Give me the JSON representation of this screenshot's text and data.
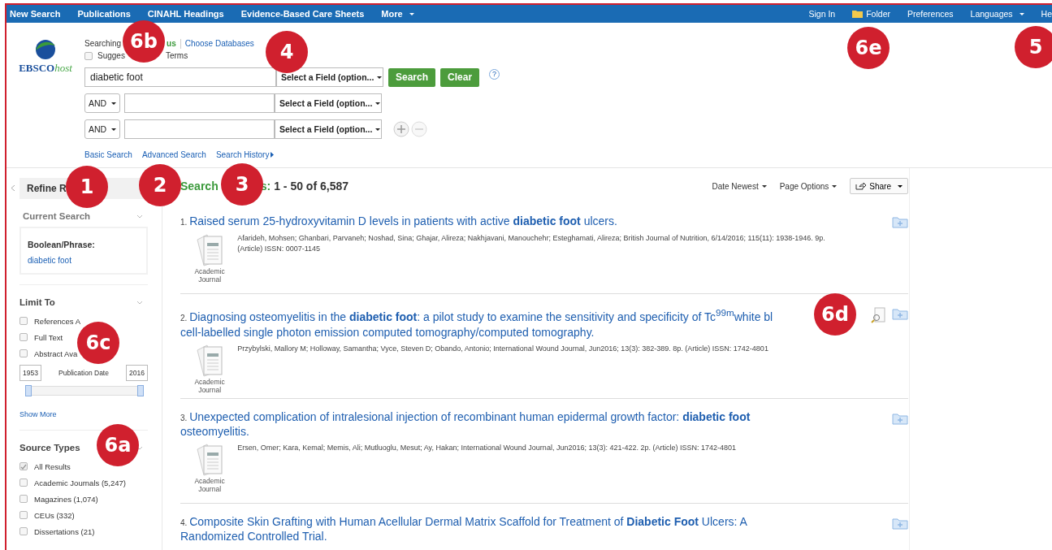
{
  "nav": {
    "left": [
      {
        "label": "New Search",
        "kind": "link"
      },
      {
        "label": "Publications",
        "kind": "link"
      },
      {
        "label": "CINAHL Headings",
        "kind": "link"
      },
      {
        "label": "Evidence-Based Care Sheets",
        "kind": "link"
      },
      {
        "label": "More",
        "kind": "dropdown"
      }
    ],
    "right": [
      {
        "label": "Sign In",
        "kind": "link"
      },
      {
        "label": "Folder",
        "kind": "folder"
      },
      {
        "label": "Preferences",
        "kind": "link"
      },
      {
        "label": "Languages",
        "kind": "dropdown"
      },
      {
        "label": "He",
        "kind": "link"
      }
    ]
  },
  "logo": {
    "text": "EBSCO",
    "suffix": "host"
  },
  "search": {
    "searching_label": "Searching",
    "database_fragment": "us",
    "choose_databases": "Choose Databases",
    "suggest": {
      "label_start": "Sugges",
      "label_end": "Terms",
      "checked": false
    },
    "rows": [
      {
        "kind": "first",
        "value": "diabetic foot",
        "field": "Select a Field (option..."
      },
      {
        "kind": "bool",
        "operator": "AND",
        "value": "",
        "field": "Select a Field (option..."
      },
      {
        "kind": "bool",
        "operator": "AND",
        "value": "",
        "field": "Select a Field (option..."
      }
    ],
    "search_button": "Search",
    "clear_button": "Clear",
    "help": "?",
    "links": [
      "Basic Search",
      "Advanced Search",
      "Search History"
    ]
  },
  "sidebar": {
    "title": "Refine R",
    "current_search": {
      "heading": "Current Search",
      "label": "Boolean/Phrase:",
      "term": "diabetic foot"
    },
    "limit_to": {
      "heading": "Limit To",
      "options": [
        {
          "label": "References A",
          "checked": false
        },
        {
          "label": "Full Text",
          "checked": false
        },
        {
          "label": "Abstract Ava",
          "checked": false
        }
      ],
      "date_from": "1953",
      "date_label": "Publication Date",
      "date_to": "2016",
      "slider": {
        "level": 1
      },
      "show_more": "Show More"
    },
    "source_types": {
      "heading": "Source Types",
      "options": [
        {
          "label": "All Results",
          "checked": true
        },
        {
          "label": "Academic Journals (5,247)",
          "checked": false
        },
        {
          "label": "Magazines (1,074)",
          "checked": false
        },
        {
          "label": "CEUs (332)",
          "checked": false
        },
        {
          "label": "Dissertations (21)",
          "checked": false
        }
      ]
    }
  },
  "results": {
    "heading_start": "Search",
    "heading_end": "s:",
    "count": "1 - 50 of 6,587",
    "sort": "Date Newest",
    "page_options": "Page Options",
    "share": "Share",
    "items": [
      {
        "number": "1.",
        "title": "Raised serum 25-hydroxyvitamin D levels in patients with active **diabetic foot** ulcers.",
        "type_label": "Academic Journal",
        "meta": "Afarideh, Mohsen; Ghanbari, Parvaneh; Noshad, Sina; Ghajar, Alireza; Nakhjavani, Manouchehr; Esteghamati, Alireza; British Journal of Nutrition, 6/14/2016; 115(11): 1938-1946. 9p. (Article) ISSN: 0007-1145",
        "preview": false
      },
      {
        "number": "2.",
        "title": "Diagnosing osteomyelitis in the **diabetic foot**: a pilot study to examine the sensitivity and specificity of Tc$^{99m}$white bl",
        "title_line2": "cell-labelled single photon emission computed tomography/computed tomography.",
        "type_label": "Academic Journal",
        "meta": "Przybylski, Mallory M; Holloway, Samantha; Vyce, Steven D; Obando, Antonio; International Wound Journal, Jun2016; 13(3): 382-389. 8p. (Article) ISSN: 1742-4801",
        "preview": true
      },
      {
        "number": "3.",
        "title": "Unexpected complication of intralesional injection of recombinant human epidermal growth factor: **diabetic foot** osteomyelitis.",
        "type_label": "Academic Journal",
        "meta": "Ersen, Omer; Kara, Kemal; Memis, Ali; Mutluoglu, Mesut; Ay, Hakan; International Wound Journal, Jun2016; 13(3): 421-422. 2p. (Article) ISSN: 1742-4801",
        "preview": false
      },
      {
        "number": "4.",
        "title": "Composite Skin Grafting with Human Acellular Dermal Matrix Scaffold for Treatment of **Diabetic Foot** Ulcers: A Randomized Controlled Trial.",
        "preview": false
      }
    ]
  },
  "callouts": [
    {
      "label": "6b"
    },
    {
      "label": "4"
    },
    {
      "label": "6e"
    },
    {
      "label": "5"
    },
    {
      "label": "1"
    },
    {
      "label": "2"
    },
    {
      "label": "3"
    },
    {
      "label": "6c"
    },
    {
      "label": "6d"
    },
    {
      "label": "6a"
    }
  ]
}
